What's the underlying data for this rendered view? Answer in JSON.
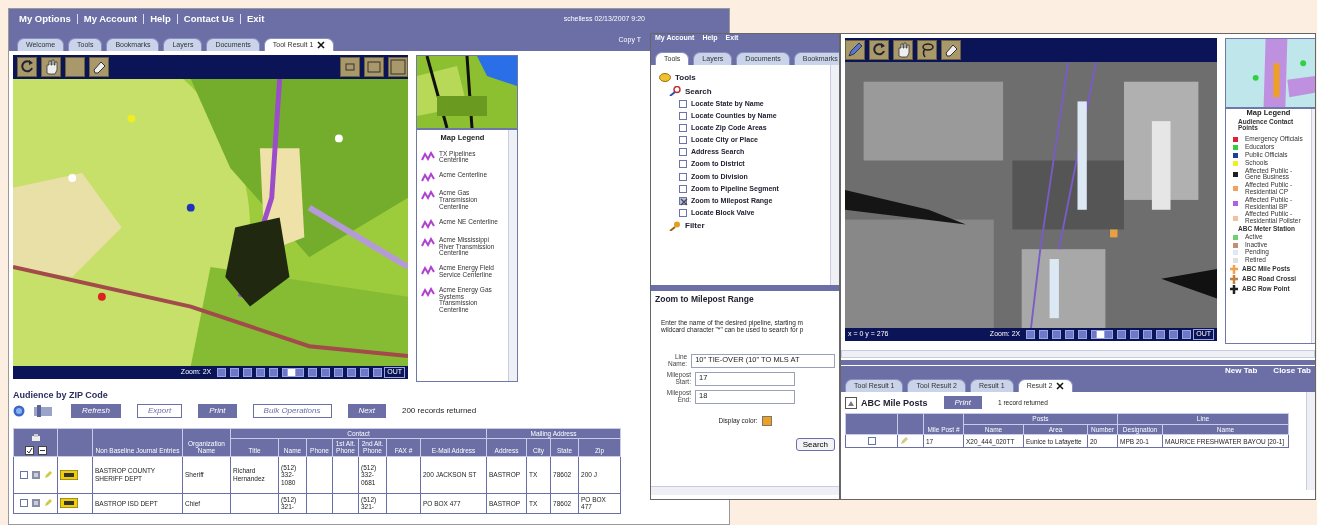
{
  "main_window": {
    "menu": [
      "My Options",
      "My Account",
      "Help",
      "Contact Us",
      "Exit"
    ],
    "user_info": "schelless 02/13/2007 9:20",
    "copy_label": "Copy T",
    "tabs": [
      {
        "label": "Welcome",
        "selected": false,
        "closable": false
      },
      {
        "label": "Tools",
        "selected": false,
        "closable": false
      },
      {
        "label": "Bookmarks",
        "selected": false,
        "closable": false
      },
      {
        "label": "Layers",
        "selected": false,
        "closable": false
      },
      {
        "label": "Documents",
        "selected": false,
        "closable": false
      },
      {
        "label": "Tool Result 1",
        "selected": true,
        "closable": true
      }
    ],
    "map": {
      "kind": "picture"
    },
    "zoom": {
      "label": "Zoom: 2X",
      "level": 0.45,
      "out_label": "OUT"
    },
    "legend": {
      "title": "Map Legend",
      "items": [
        "TX Pipelines Centerline",
        "Acme Centerline",
        "Acme Gas Transmission Centerline",
        "Acme NE Centerline",
        "Acme Mississippi River Transmission Centerline",
        "Acme Energy Field Service Centerline",
        "Acme Energy Gas Systems Transmission Centerline"
      ]
    },
    "results": {
      "title": "Audience by ZIP Code",
      "buttons": [
        {
          "label": "Refresh",
          "kind": "filled"
        },
        {
          "label": "Export",
          "kind": "outline"
        },
        {
          "label": "Print",
          "kind": "filled"
        },
        {
          "label": "Bulk Operations",
          "kind": "outline"
        },
        {
          "label": "Next",
          "kind": "filled"
        }
      ],
      "count": "200 records returned"
    },
    "table": {
      "header": [
        {
          "label": "Non Baseline Journal Entries"
        },
        {
          "label": "Organization Name"
        },
        {
          "group": "Contact",
          "columns": [
            "Title",
            "Name",
            "Phone",
            "1st Alt. Phone",
            "2nd Alt. Phone",
            "FAX #",
            "E-Mail Address"
          ]
        },
        {
          "group": "Mailing Address",
          "columns": [
            "Address",
            "City",
            "State",
            "Zip"
          ]
        }
      ],
      "rows": [
        {
          "checked": false,
          "cells": [
            "BASTROP COUNTY SHERIFF DEPT",
            "Sheriff",
            "Richard Hernandez",
            "(512) 332-1080",
            "",
            "",
            "(512) 332-0681",
            "",
            "200 JACKSON ST",
            "BASTROP",
            "TX",
            "78602",
            "200 J"
          ]
        },
        {
          "checked": false,
          "cells": [
            "BASTROP ISD DEPT",
            "Chief",
            "",
            "(512) 321-",
            "",
            "",
            "(512) 321-",
            "",
            "PO BOX 477",
            "BASTROP",
            "TX",
            "78602",
            "PO BOX 477"
          ]
        }
      ]
    }
  },
  "tools_window": {
    "menu": [
      "My Account",
      "Help",
      "Exit"
    ],
    "tabs": [
      {
        "label": "Tools",
        "selected": true
      },
      {
        "label": "Layers",
        "selected": false
      },
      {
        "label": "Documents",
        "selected": false
      },
      {
        "label": "Bookmarks",
        "selected": false
      }
    ],
    "tree": [
      {
        "label": "Tools",
        "kind": "root",
        "children": [
          {
            "label": "Search",
            "kind": "search",
            "children": [
              {
                "label": "Locate State by Name",
                "kind": "option",
                "checked": false
              },
              {
                "label": "Locate Counties by Name",
                "kind": "option",
                "checked": false
              },
              {
                "label": "Locate Zip Code Areas",
                "kind": "option",
                "checked": false
              },
              {
                "label": "Locate City or Place",
                "kind": "option",
                "checked": false
              },
              {
                "label": "Address Search",
                "kind": "option",
                "checked": false
              },
              {
                "label": "Zoom to District",
                "kind": "option",
                "checked": false
              },
              {
                "label": "Zoom to Division",
                "kind": "option",
                "checked": false
              },
              {
                "label": "Zoom to Pipeline Segment",
                "kind": "option",
                "checked": false
              },
              {
                "label": "Zoom to Milepost Range",
                "kind": "option",
                "checked": true
              },
              {
                "label": "Locate Block Valve",
                "kind": "option",
                "checked": false
              }
            ]
          },
          {
            "label": "Filter",
            "kind": "filter"
          }
        ]
      }
    ],
    "form": {
      "title": "Zoom to Milepost Range",
      "description_lines": [
        "Enter the name of the desired pipeline, starting m",
        "wildcard character \"*\" can be used to search for p"
      ],
      "fields": [
        {
          "label": "Line Name:",
          "value": "10\" TIE-OVER (10\" TO MLS AT"
        },
        {
          "label": "Milepost Start:",
          "value": "17"
        },
        {
          "label": "Milepost End:",
          "value": "18"
        }
      ],
      "color_label": "Display color:",
      "color": "#f0a020",
      "button": "Search"
    }
  },
  "map_window": {
    "coords": "x = 0 y = 276",
    "zoom": {
      "label": "Zoom: 2X",
      "level": 0.45,
      "out_label": "OUT"
    },
    "legend": {
      "title": "Map Legend",
      "subtitle": "Audience Contact Points",
      "items": [
        {
          "kind": "dot",
          "label": "Emergency Officials",
          "color": "#e0203a"
        },
        {
          "kind": "dot",
          "label": "Educators",
          "color": "#30d040"
        },
        {
          "kind": "dot",
          "label": "Public Officials",
          "color": "#2040a0"
        },
        {
          "kind": "dot",
          "label": "Schools",
          "color": "#f0f020"
        },
        {
          "kind": "dot",
          "label": "Affected Public - Gene Business",
          "color": "#202020"
        },
        {
          "kind": "dot",
          "label": "Affected Public - Residential CP",
          "color": "#f0a060"
        },
        {
          "kind": "dot",
          "label": "Affected Public - Residential BP",
          "color": "#b060e0"
        },
        {
          "kind": "dot",
          "label": "Affected Public - Residential Pollster",
          "color": "#f0c0a0"
        },
        {
          "kind": "heading",
          "label": "ABC Meter Station"
        },
        {
          "kind": "dot",
          "label": "Active",
          "color": "#70d070"
        },
        {
          "kind": "dot",
          "label": "Inactive",
          "color": "#c09070"
        },
        {
          "kind": "dot",
          "label": "Pending",
          "color": "#e0e8f8"
        },
        {
          "kind": "dot",
          "label": "Retired",
          "color": "#e0e0e0"
        },
        {
          "kind": "marker",
          "label": "ABC Mile Posts",
          "color": "#f0a050"
        },
        {
          "kind": "marker",
          "label": "ABC Road Crossi",
          "color": "#c08040"
        },
        {
          "kind": "marker",
          "label": "ABC Row Point",
          "color": "#202020"
        }
      ]
    },
    "links": [
      "New Tab",
      "Close Tab"
    ],
    "tabs": [
      {
        "label": "Tool Result 1",
        "selected": false,
        "closable": false
      },
      {
        "label": "Tool Result 2",
        "selected": false,
        "closable": false
      },
      {
        "label": "Result 1",
        "selected": false,
        "closable": false
      },
      {
        "label": "Result 2",
        "selected": true,
        "closable": true
      }
    ],
    "results": {
      "title": "ABC Mile Posts",
      "button": "Print",
      "count": "1 record returned"
    },
    "table": {
      "header": [
        {
          "label": "Mile Post #"
        },
        {
          "group": "Posts",
          "columns": [
            "Name",
            "Area",
            "Number"
          ]
        },
        {
          "group": "Line",
          "columns": [
            "Designation",
            "Name"
          ]
        }
      ],
      "rows": [
        {
          "checked": false,
          "cells": [
            "17",
            "X20_444_020TT",
            "Eunice to Lafayette",
            "20",
            "MPB 20-1",
            "MAURICE FRESHWATER BAYOU [20-1]"
          ]
        }
      ]
    }
  }
}
